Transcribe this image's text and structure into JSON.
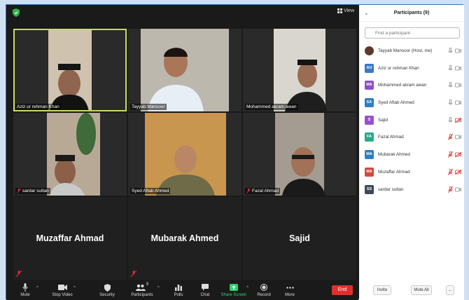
{
  "gallery": {
    "view_label": "View",
    "tiles": [
      {
        "name": "Aziz ur rehman Khan",
        "muted": false,
        "video": true
      },
      {
        "name": "Tayyab Mansoor",
        "muted": false,
        "video": true
      },
      {
        "name": "Mohammed akram awan",
        "muted": false,
        "video": true
      },
      {
        "name": "sardar sultan",
        "muted": true,
        "video": true
      },
      {
        "name": "Syed Aftab Ahmed",
        "muted": false,
        "video": true
      },
      {
        "name": "Fazal Ahmad",
        "muted": true,
        "video": true
      },
      {
        "name": "Muzaffar Ahmad",
        "muted": true,
        "video": false
      },
      {
        "name": "Mubarak Ahmed",
        "muted": true,
        "video": false
      },
      {
        "name": "Sajid",
        "muted": false,
        "video": false
      }
    ]
  },
  "toolbar": {
    "mute": "Mute",
    "stop_video": "Stop Video",
    "security": "Security",
    "participants": "Participants",
    "participants_count": "9",
    "polls": "Polls",
    "chat": "Chat",
    "share_screen": "Share Screen",
    "record": "Record",
    "more": "More",
    "end": "End"
  },
  "panel": {
    "title": "Participants (9)",
    "search_placeholder": "Find a participant",
    "participants": [
      {
        "initials": "",
        "name": "Tayyab Mansoor (Host, me)",
        "color": "#5a3a2a",
        "mic": "on",
        "cam": "on"
      },
      {
        "initials": "AU",
        "name": "Aziz ur rehman Khan",
        "color": "#3a78c8",
        "mic": "on",
        "cam": "on"
      },
      {
        "initials": "MA",
        "name": "Mohammed akram awan",
        "color": "#8e4fc4",
        "mic": "on",
        "cam": "on"
      },
      {
        "initials": "SA",
        "name": "Syed Aftab Ahmed",
        "color": "#2f7fc0",
        "mic": "on",
        "cam": "on"
      },
      {
        "initials": "S",
        "name": "Sajid",
        "color": "#9b4fcf",
        "mic": "on",
        "cam": "off"
      },
      {
        "initials": "FA",
        "name": "Fazal Ahmad",
        "color": "#2aa889",
        "mic": "off",
        "cam": "on"
      },
      {
        "initials": "MA",
        "name": "Mubarak Ahmed",
        "color": "#2f7fc0",
        "mic": "off",
        "cam": "off"
      },
      {
        "initials": "MA",
        "name": "Muzaffar Ahmad",
        "color": "#d24a3a",
        "mic": "off",
        "cam": "off"
      },
      {
        "initials": "SS",
        "name": "sardar sultan",
        "color": "#3e4a5a",
        "mic": "off",
        "cam": "on"
      }
    ],
    "invite": "Invite",
    "mute_all": "Mute All",
    "more": "..."
  },
  "colors": {
    "accent_green": "#2fd16a",
    "end_red": "#e0302d",
    "active_speaker": "#c9de5a",
    "muted_red": "#e0302d"
  }
}
